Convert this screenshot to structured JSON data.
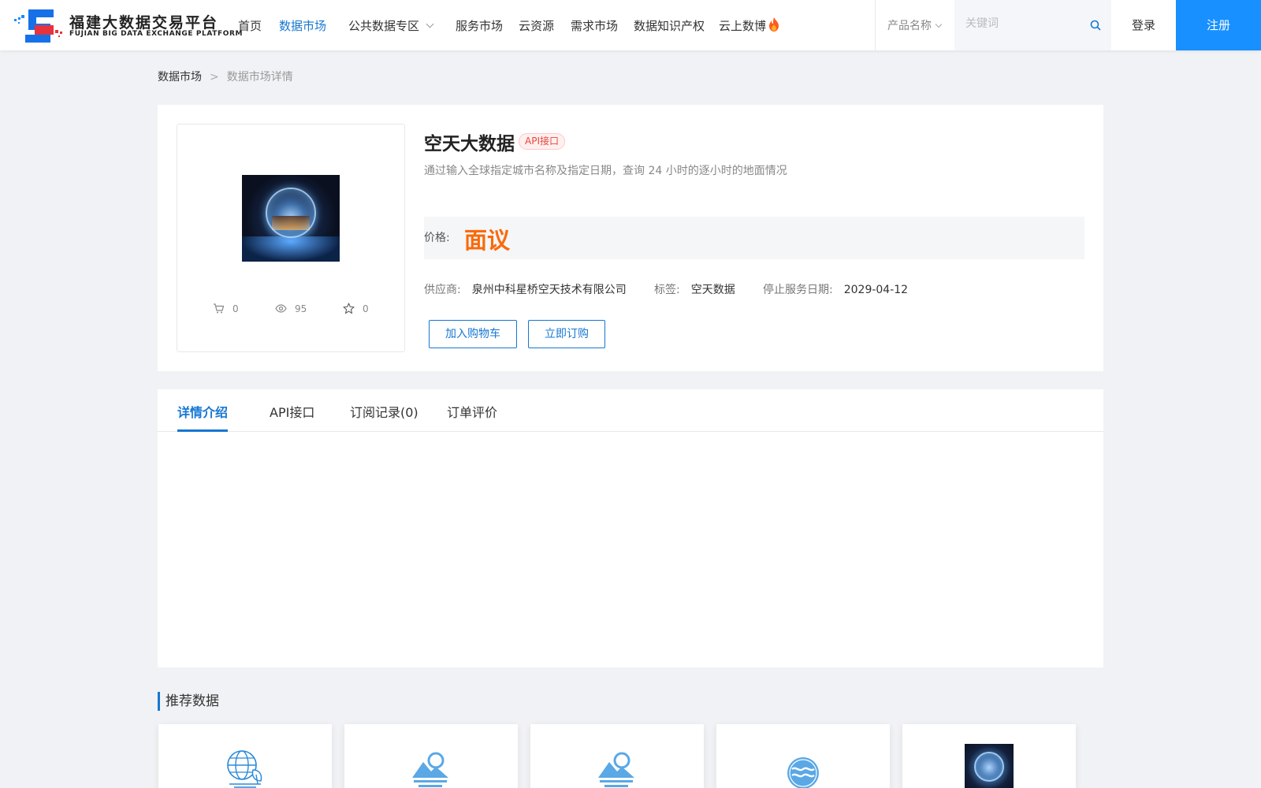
{
  "header": {
    "logo_cn": "福建大数据交易平台",
    "logo_en": "FUJIAN BIG DATA EXCHANGE  PLATFORM",
    "nav": [
      {
        "label": "首页",
        "active": false
      },
      {
        "label": "数据市场",
        "active": true
      },
      {
        "label": "公共数据专区",
        "active": false,
        "dropdown": true
      },
      {
        "label": "服务市场",
        "active": false
      },
      {
        "label": "云资源",
        "active": false
      },
      {
        "label": "需求市场",
        "active": false
      },
      {
        "label": "数据知识产权",
        "active": false
      },
      {
        "label": "云上数博",
        "active": false,
        "icon": "flame-icon"
      }
    ],
    "search_type": "产品名称",
    "search_placeholder": "关键词",
    "login": "登录",
    "register": "注册"
  },
  "breadcrumb": {
    "root": "数据市场",
    "separator": ">",
    "current": "数据市场详情"
  },
  "product": {
    "title": "空天大数据",
    "badge": "API接口",
    "description": "通过输入全球指定城市名称及指定日期，查询 24 小时的逐小时的地面情况",
    "price_label": "价格:",
    "price_value": "面议",
    "supplier_label": "供应商:",
    "supplier": "泉州中科星桥空天技术有限公司",
    "tag_label": "标签:",
    "tag": "空天数据",
    "end_date_label": "停止服务日期:",
    "end_date": "2029-04-12",
    "add_to_cart": "加入购物车",
    "subscribe": "立即订购",
    "stats": {
      "cart": "0",
      "views": "95",
      "favorites": "0"
    }
  },
  "tabs": [
    {
      "label": "详情介绍",
      "active": true
    },
    {
      "label": "API接口",
      "active": false
    },
    {
      "label": "订阅记录(0)",
      "active": false
    },
    {
      "label": "订单评价",
      "active": false
    }
  ],
  "recommended": {
    "title": "推荐数据",
    "cards": [
      {
        "icon": "globe-plant-icon"
      },
      {
        "icon": "mountain-sun-icon"
      },
      {
        "icon": "mountain-sun-icon"
      },
      {
        "icon": "water-wave-icon"
      },
      {
        "icon": "crystal-ball-image"
      }
    ]
  },
  "colors": {
    "accent": "#1677d2",
    "primary_button": "#1890ff",
    "price": "#fa6a0a",
    "badge_text": "#e8453c"
  }
}
